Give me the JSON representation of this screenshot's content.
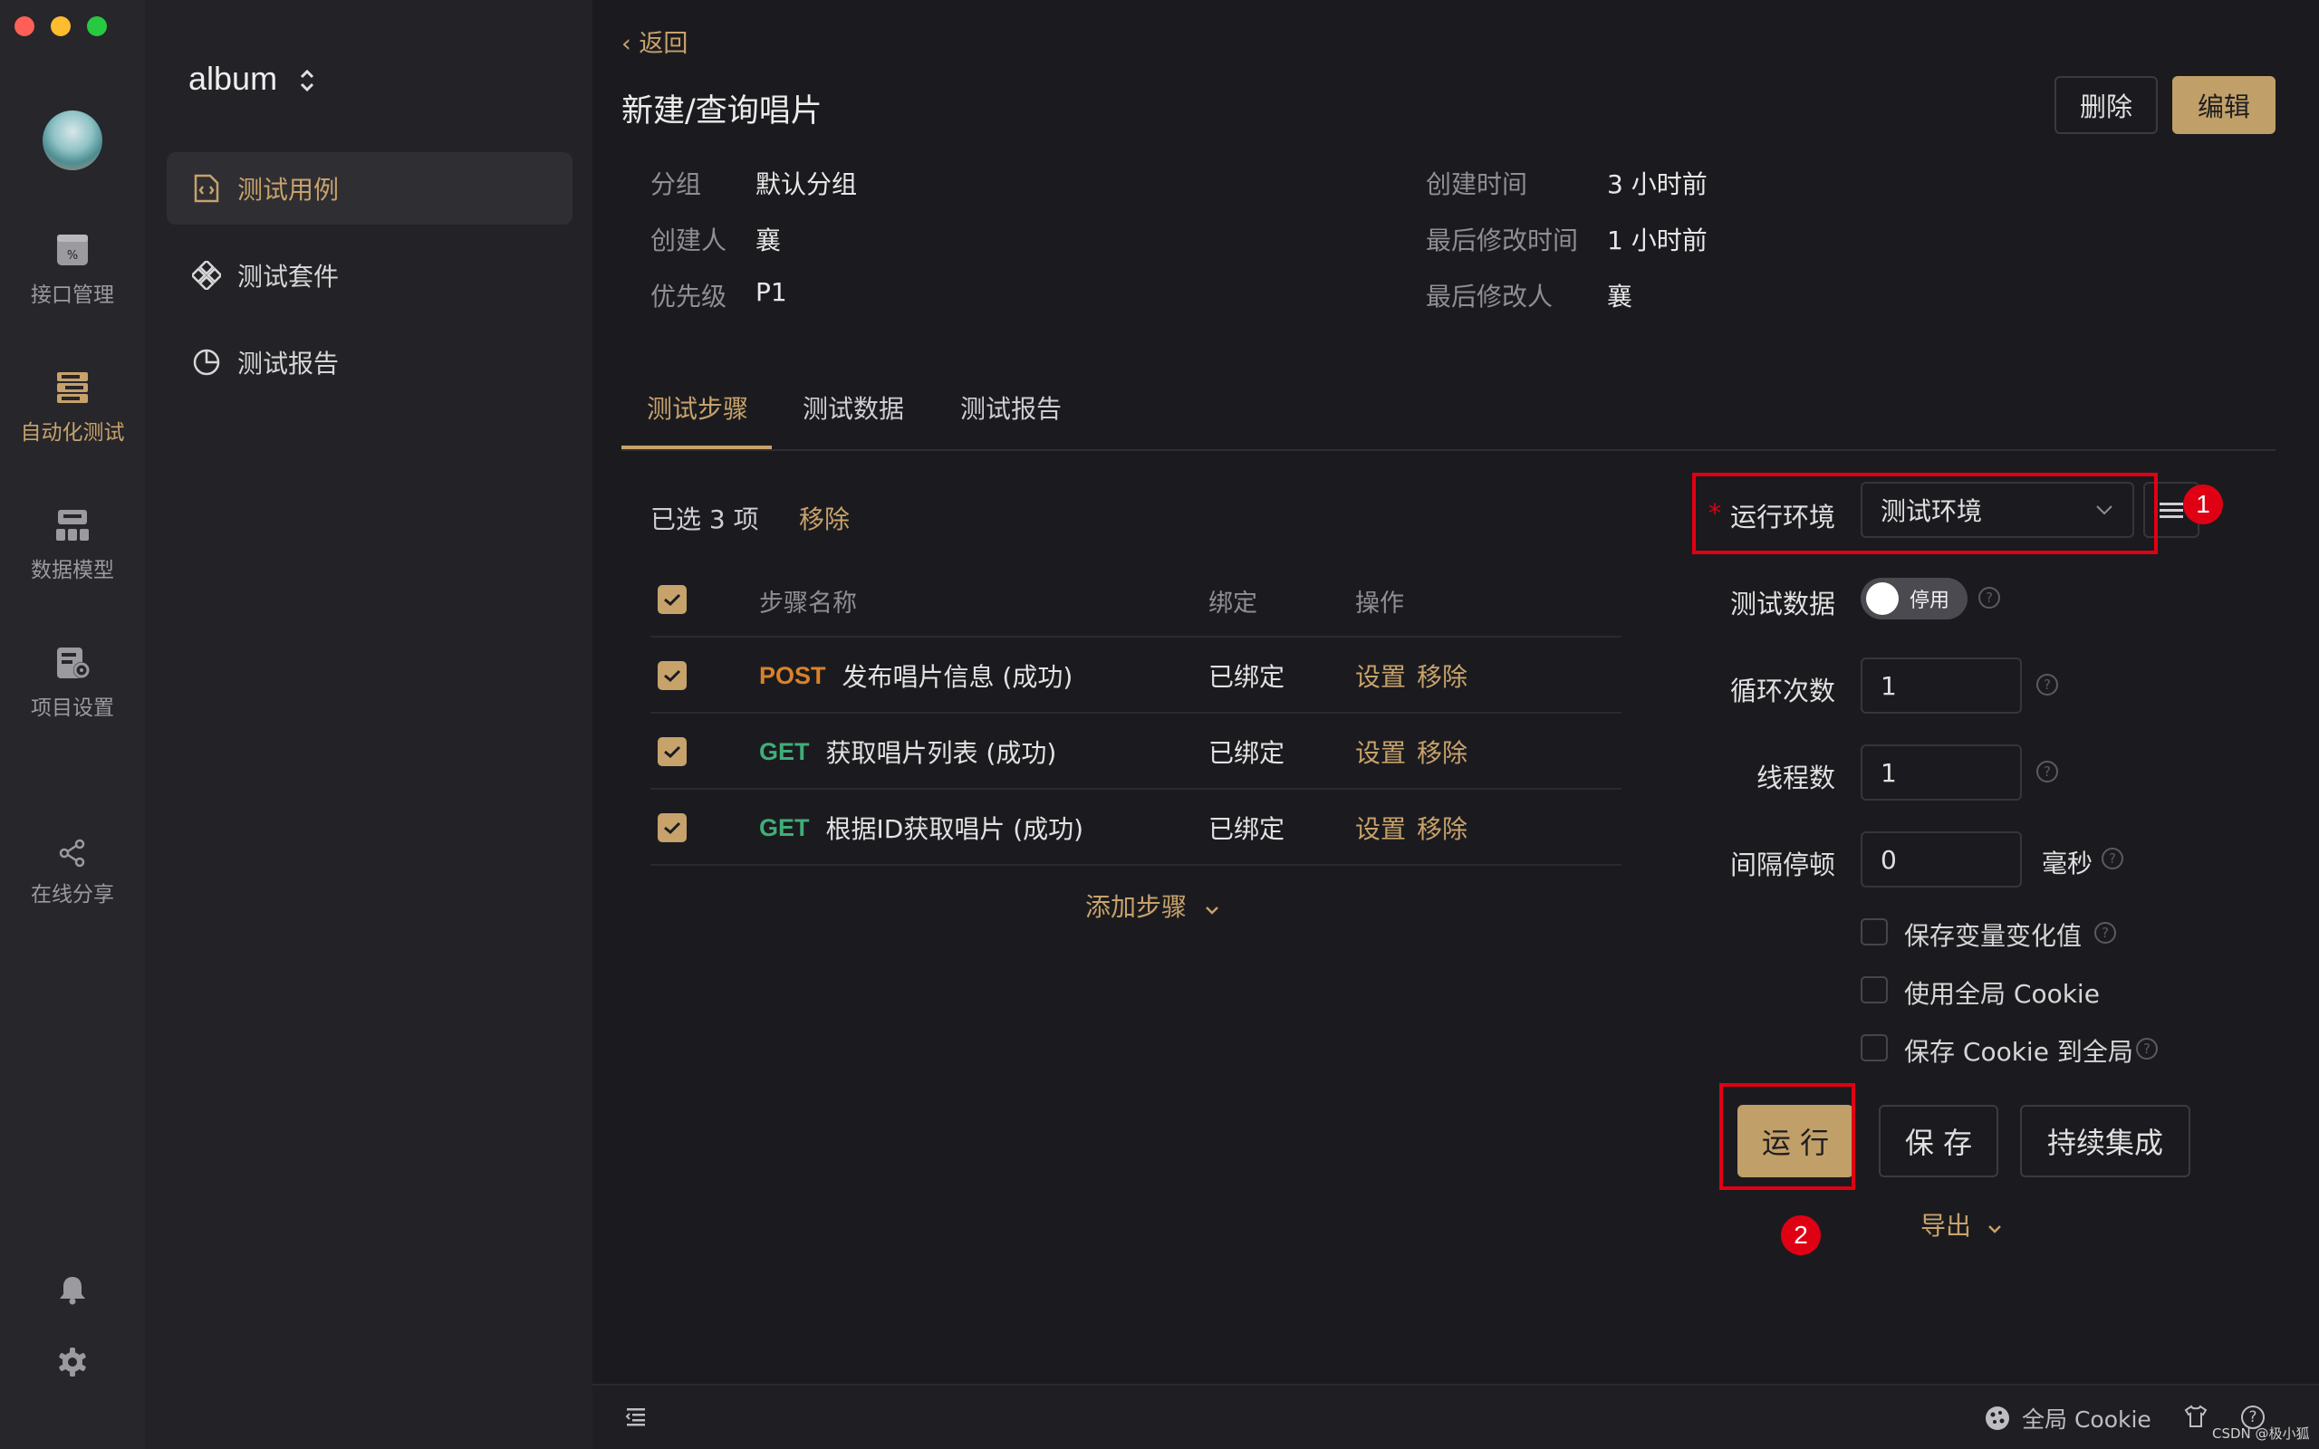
{
  "window": {
    "traffic": {
      "close": "#ff5f57",
      "minimize": "#febc2e",
      "maximize": "#28c840"
    }
  },
  "rail": {
    "items": [
      {
        "label": "接口管理",
        "icon": "api-icon"
      },
      {
        "label": "自动化测试",
        "icon": "automation-icon",
        "active": true
      },
      {
        "label": "数据模型",
        "icon": "data-model-icon"
      },
      {
        "label": "项目设置",
        "icon": "project-settings-icon"
      },
      {
        "label": "在线分享",
        "icon": "share-icon"
      }
    ]
  },
  "sidebar": {
    "project": "album",
    "items": [
      {
        "label": "测试用例",
        "icon": "test-case-icon",
        "active": true
      },
      {
        "label": "测试套件",
        "icon": "test-suite-icon"
      },
      {
        "label": "测试报告",
        "icon": "test-report-icon"
      }
    ]
  },
  "header": {
    "back": "返回",
    "title": "新建/查询唱片",
    "delete": "删除",
    "edit": "编辑"
  },
  "meta": {
    "group_label": "分组",
    "group_value": "默认分组",
    "creator_label": "创建人",
    "creator_value": "襄",
    "priority_label": "优先级",
    "priority_value": "P1",
    "created_label": "创建时间",
    "created_value": "3 小时前",
    "modified_label": "最后修改时间",
    "modified_value": "1 小时前",
    "modifier_label": "最后修改人",
    "modifier_value": "襄"
  },
  "tabs": [
    "测试步骤",
    "测试数据",
    "测试报告"
  ],
  "steps": {
    "selected_text": "已选 3 项",
    "remove_selected": "移除",
    "columns": [
      "步骤名称",
      "绑定",
      "操作"
    ],
    "rows": [
      {
        "method": "POST",
        "method_color": "#d9822b",
        "name": "发布唱片信息 (成功)",
        "binding": "已绑定",
        "setting": "设置",
        "remove": "移除"
      },
      {
        "method": "GET",
        "method_color": "#3fae78",
        "name": "获取唱片列表 (成功)",
        "binding": "已绑定",
        "setting": "设置",
        "remove": "移除"
      },
      {
        "method": "GET",
        "method_color": "#3fae78",
        "name": "根据ID获取唱片 (成功)",
        "binding": "已绑定",
        "setting": "设置",
        "remove": "移除"
      }
    ],
    "add_step": "添加步骤"
  },
  "run_form": {
    "env_label": "运行环境",
    "env_value": "测试环境",
    "test_data_label": "测试数据",
    "test_data_toggle": "停用",
    "loop_label": "循环次数",
    "loop_value": "1",
    "threads_label": "线程数",
    "threads_value": "1",
    "interval_label": "间隔停顿",
    "interval_value": "0",
    "interval_unit": "毫秒",
    "opt_save_vars": "保存变量变化值",
    "opt_global_cookie": "使用全局 Cookie",
    "opt_save_cookie": "保存 Cookie 到全局",
    "run": "运 行",
    "save": "保 存",
    "ci": "持续集成",
    "export": "导出"
  },
  "annotations": {
    "badge1": "1",
    "badge2": "2",
    "color": "#e00014"
  },
  "bottom": {
    "global_cookie": "全局 Cookie",
    "watermark": "CSDN @极小狐"
  },
  "colors": {
    "accent": "#c7a26b",
    "gold_button": "#c19f68"
  }
}
